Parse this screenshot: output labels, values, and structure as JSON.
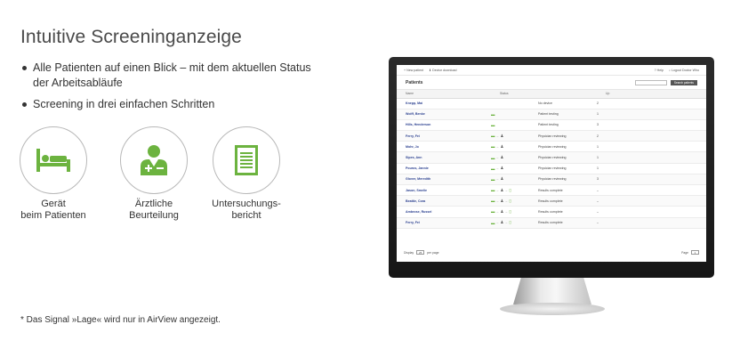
{
  "heading": "Intuitive Screeninganzeige",
  "bullets": [
    "Alle Patienten auf einen Blick – mit dem aktuellen Status der Arbeitsabläufe",
    "Screening in drei einfachen Schritten"
  ],
  "icons": [
    {
      "name": "bed-icon",
      "label": "Gerät\nbeim Patienten",
      "color": "#6cb33f"
    },
    {
      "name": "doctor-icon",
      "label": "Ärztliche\nBeurteilung",
      "color": "#6cb33f"
    },
    {
      "name": "report-icon",
      "label": "Untersuchungs-\nbericht",
      "color": "#6cb33f"
    }
  ],
  "footnote": "* Das Signal »Lage« wird nur in AirView angezeigt.",
  "screen": {
    "toolbar": {
      "new_patient": "New patient",
      "device_download": "Device download",
      "help": "Help",
      "logout": "Logout Doctor Who"
    },
    "page_title": "Patients",
    "search_button": "Search patients",
    "columns": {
      "name": "Name",
      "status": "Status",
      "up": "Up"
    },
    "rows": [
      {
        "name": "Knepp, Mai",
        "symbols": [],
        "status": "No device",
        "up": "2"
      },
      {
        "name": "Wolff, Benke",
        "symbols": [
          "device"
        ],
        "status": "Patient testing",
        "up": "1"
      },
      {
        "name": "Hills, Henderson",
        "symbols": [
          "device"
        ],
        "status": "Patient testing",
        "up": "3"
      },
      {
        "name": "Ferry, Fei",
        "symbols": [
          "device",
          "doctor"
        ],
        "status": "Physician reviewing",
        "up": "2"
      },
      {
        "name": "Mohr, Jo",
        "symbols": [
          "device",
          "doctor"
        ],
        "status": "Physician reviewing",
        "up": "1"
      },
      {
        "name": "Sipes, Ann",
        "symbols": [
          "device",
          "doctor"
        ],
        "status": "Physician reviewing",
        "up": "1"
      },
      {
        "name": "Pouros, Jannie",
        "symbols": [
          "device",
          "doctor"
        ],
        "status": "Physician reviewing",
        "up": "1"
      },
      {
        "name": "Glover, Meredith",
        "symbols": [
          "device",
          "doctor"
        ],
        "status": "Physician reviewing",
        "up": "3"
      },
      {
        "name": "Jason, Smelie",
        "symbols": [
          "device",
          "doctor",
          "report"
        ],
        "status": "Results complete",
        "up": "–"
      },
      {
        "name": "Beattie, Cora",
        "symbols": [
          "device",
          "doctor",
          "report"
        ],
        "status": "Results complete",
        "up": "–"
      },
      {
        "name": "Ambrose, Russel",
        "symbols": [
          "device",
          "doctor",
          "report"
        ],
        "status": "Results complete",
        "up": "–"
      },
      {
        "name": "Ferry, Fei",
        "symbols": [
          "device",
          "doctor",
          "report"
        ],
        "status": "Results complete",
        "up": "–"
      }
    ],
    "footer": {
      "display_label": "Display",
      "per_page_value": "25",
      "per_page_label": "per page",
      "page_label": "Page",
      "page_value": "1"
    }
  }
}
